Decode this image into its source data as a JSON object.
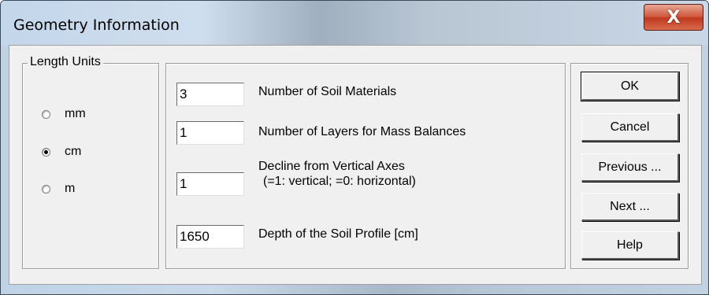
{
  "window": {
    "title": "Geometry Information",
    "close_symbol": "X"
  },
  "length_units": {
    "label": "Length Units",
    "options": [
      {
        "label": "mm",
        "checked": false
      },
      {
        "label": "cm",
        "checked": true
      },
      {
        "label": "m",
        "checked": false
      }
    ]
  },
  "fields": [
    {
      "value": "3",
      "label": "Number of Soil Materials"
    },
    {
      "value": "1",
      "label": "Number of Layers for Mass Balances"
    },
    {
      "value": "1",
      "label": "Decline from Vertical Axes",
      "sublabel": "(=1: vertical; =0: horizontal)"
    },
    {
      "value": "1650",
      "label": "Depth of the Soil Profile [cm]"
    }
  ],
  "buttons": {
    "ok": "OK",
    "cancel": "Cancel",
    "previous": "Previous ...",
    "next": "Next ...",
    "help": "Help"
  },
  "icons": {
    "close": "close-icon",
    "radio": "radio-button-icon"
  }
}
